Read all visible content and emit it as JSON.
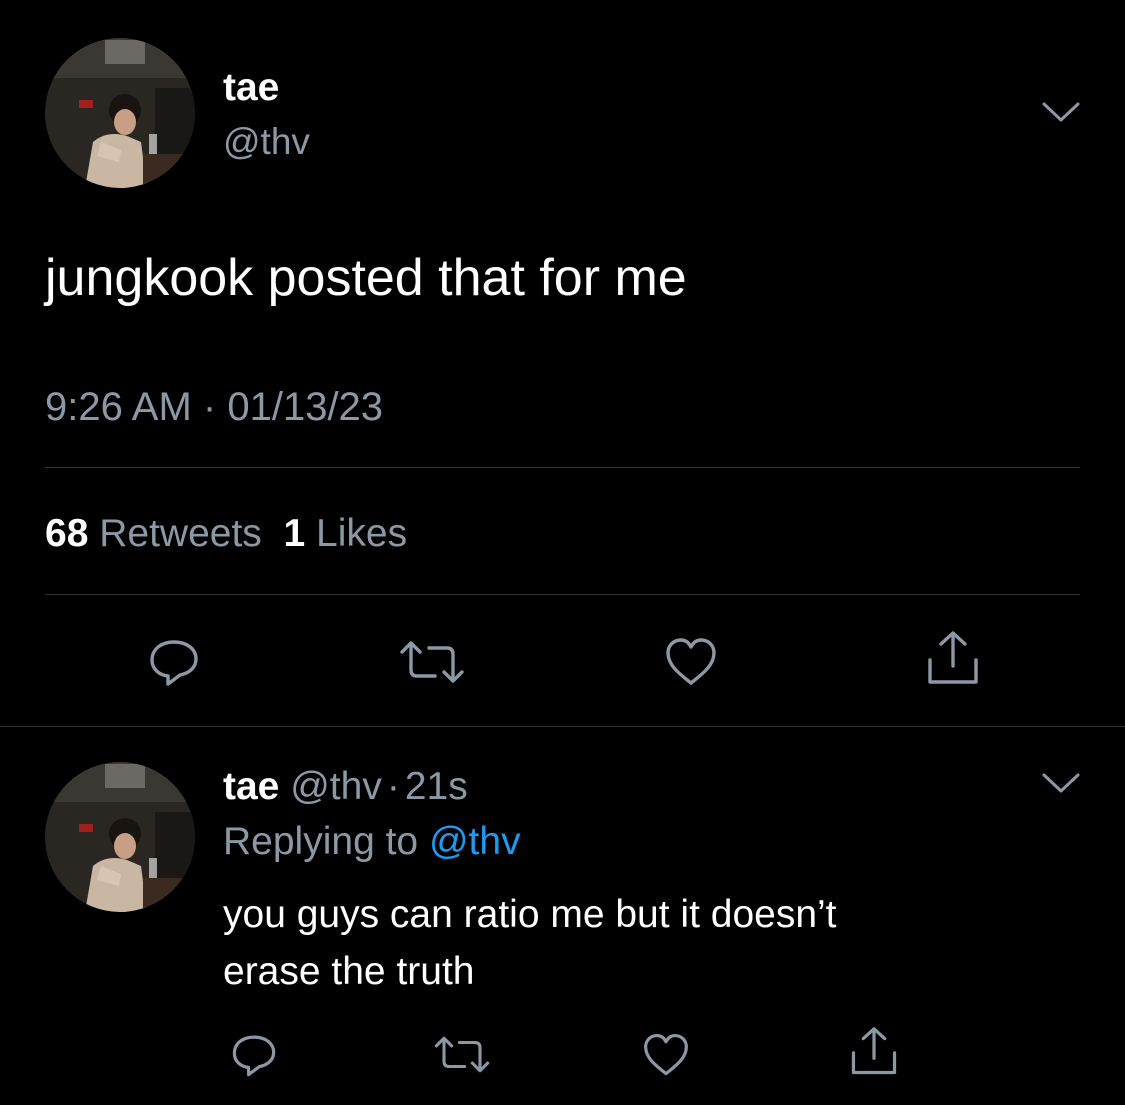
{
  "main_tweet": {
    "author_name": "tae",
    "author_handle": "@thv",
    "text": "jungkook posted that for me",
    "time": "9:26 AM",
    "separator": "·",
    "date": "01/13/23",
    "retweet_count": "68",
    "retweet_label": "Retweets",
    "like_count": "1",
    "like_label": "Likes"
  },
  "reply_tweet": {
    "author_name": "tae",
    "author_handle": "@thv",
    "separator": "·",
    "age": "21s",
    "replying_prefix": "Replying to",
    "replying_handle": "@thv",
    "text_line1": "you guys can ratio me but it doesn’t",
    "text_line2": "erase the truth"
  },
  "icons": {
    "reply": "speech-bubble-icon",
    "retweet": "retweet-arrows-icon",
    "like": "heart-outline-icon",
    "share": "share-upload-icon",
    "more": "chevron-down-icon"
  },
  "colors": {
    "background": "#000000",
    "primary_text": "#ffffff",
    "secondary_text": "#8b98a5",
    "link": "#1d9bf0",
    "divider": "#2f3336"
  }
}
